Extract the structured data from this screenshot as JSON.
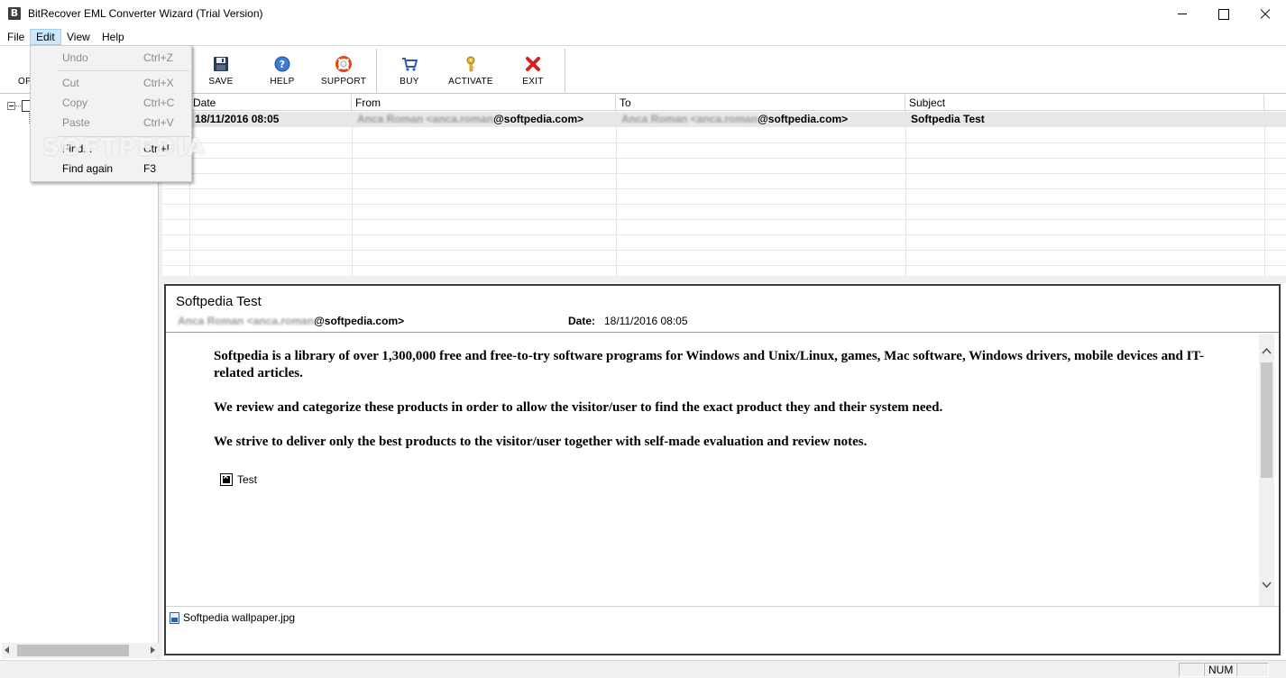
{
  "window": {
    "app_icon": "B",
    "title": "BitRecover EML Converter Wizard (Trial Version)"
  },
  "menu": {
    "items": [
      "File",
      "Edit",
      "View",
      "Help"
    ],
    "active": "Edit"
  },
  "toolbar": {
    "open_label_partial": "OP",
    "buttons": [
      {
        "label": "SAVE",
        "icon": "floppy-disk-icon"
      },
      {
        "label": "HELP",
        "icon": "help-circle-icon"
      },
      {
        "label": "SUPPORT",
        "icon": "lifebuoy-icon"
      },
      {
        "label": "BUY",
        "icon": "shopping-cart-icon"
      },
      {
        "label": "ACTIVATE",
        "icon": "key-icon"
      },
      {
        "label": "EXIT",
        "icon": "red-x-icon"
      }
    ]
  },
  "edit_menu": {
    "items": [
      {
        "label": "Undo",
        "shortcut": "Ctrl+Z",
        "enabled": false
      },
      {
        "label": "Cut",
        "shortcut": "Ctrl+X",
        "enabled": false
      },
      {
        "label": "Copy",
        "shortcut": "Ctrl+C",
        "enabled": false
      },
      {
        "label": "Paste",
        "shortcut": "Ctrl+V",
        "enabled": false
      },
      {
        "label": "Find...",
        "shortcut": "Ctrl+F",
        "enabled": true
      },
      {
        "label": "Find again",
        "shortcut": "F3",
        "enabled": true
      }
    ],
    "watermark": "SOFTPEDIA"
  },
  "grid": {
    "columns": [
      "Date",
      "From",
      "To",
      "Subject"
    ],
    "rows": [
      {
        "date": "18/11/2016 08:05",
        "from_hidden": "Anca Roman <anca.roman",
        "from_visible": "@softpedia.com>",
        "to_hidden": "Anca Roman <anca.roman",
        "to_visible": "@softpedia.com>",
        "subject": "Softpedia Test"
      }
    ]
  },
  "preview": {
    "subject": "Softpedia Test",
    "from_hidden": "Anca Roman <anca.roman",
    "from_visible": "@softpedia.com>",
    "date_label": "Date:",
    "date_value": "18/11/2016 08:05",
    "paragraphs": [
      "Softpedia is a library of over 1,300,000 free and free-to-try software programs for Windows and Unix/Linux, games, Mac software, Windows drivers, mobile devices and IT-related articles.",
      "We review and categorize these products in order to allow the visitor/user to find the exact product they and their system need.",
      "We strive to deliver only the best products to the visitor/user together with self-made evaluation and review notes."
    ],
    "image_alt": "Test",
    "attachment": "Softpedia wallpaper.jpg"
  },
  "statusbar": {
    "num": "NUM"
  }
}
